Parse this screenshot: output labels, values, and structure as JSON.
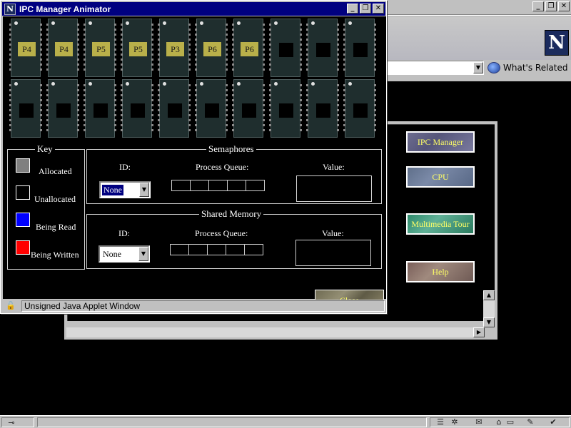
{
  "browser": {
    "window_buttons": [
      "_",
      "❐",
      "✕"
    ],
    "logo_letter": "N",
    "whats_related": "What's Related",
    "dropdown_glyph": "▼",
    "scroll_up": "▲",
    "scroll_down": "▼",
    "scroll_right": "▶",
    "nav_buttons": {
      "ipc_manager": "IPC Manager",
      "cpu": "CPU",
      "multimedia_tour": "Multimedia Tour",
      "help": "Help"
    }
  },
  "applet": {
    "title": "IPC Manager Animator",
    "app_icon_letter": "N",
    "window_buttons": [
      "_",
      "❐",
      "✕"
    ],
    "chips_row1": [
      "P4",
      "P4",
      "P5",
      "P5",
      "P3",
      "P6",
      "P6",
      "",
      "",
      ""
    ],
    "chips_row2": [
      "",
      "",
      "",
      "",
      "",
      "",
      "",
      "",
      "",
      ""
    ],
    "key": {
      "title": "Key",
      "items": [
        {
          "label": "Allocated",
          "color": "#808080"
        },
        {
          "label": "Unallocated",
          "color": "#000000"
        },
        {
          "label": "Being Read",
          "color": "#0000ff"
        },
        {
          "label": "Being Written",
          "color": "#ff0000"
        }
      ]
    },
    "semaphores": {
      "title": "Semaphores",
      "id_label": "ID:",
      "queue_label": "Process Queue:",
      "value_label": "Value:",
      "id_selected": "None"
    },
    "shared_memory": {
      "title": "Shared Memory",
      "id_label": "ID:",
      "queue_label": "Process Queue:",
      "value_label": "Value:",
      "id_selected": "None"
    },
    "close_label": "Close",
    "status_text": "Unsigned Java Applet Window"
  }
}
